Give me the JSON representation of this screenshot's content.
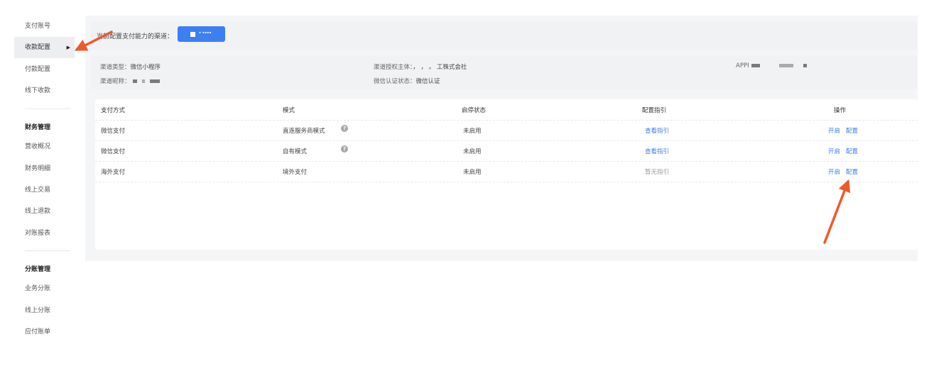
{
  "sidebar": {
    "items_top": [
      {
        "label": "支付账号"
      },
      {
        "label": "收款配置"
      },
      {
        "label": "付款配置"
      },
      {
        "label": "线下收款"
      }
    ],
    "group_finance": {
      "title": "财务管理",
      "items": [
        {
          "label": "营收概况"
        },
        {
          "label": "财务明细"
        },
        {
          "label": "线上交易"
        },
        {
          "label": "线上退款"
        },
        {
          "label": "对账报表"
        }
      ]
    },
    "group_split": {
      "title": "分账管理",
      "items": [
        {
          "label": "业务分账"
        },
        {
          "label": "线上分账"
        },
        {
          "label": "应付账单"
        }
      ]
    }
  },
  "channel_bar": {
    "label": "当前配置支付能力的渠道：",
    "chip_text": "▪ ▪▪▪▪"
  },
  "info": {
    "type_label": "渠道类型：",
    "type_value": "微信小程序",
    "subject_label": "渠道授权主体：",
    "subject_value": "，    ，  。  工株式会社",
    "appid_label": "APPI",
    "nickname_label": "渠道昵称：",
    "wechat_auth_label": "微信认证状态：",
    "wechat_auth_value": "微信认证"
  },
  "table": {
    "headers": {
      "method": "支付方式",
      "mode": "模式",
      "status": "启停状态",
      "guide": "配置指引",
      "ops": "操作"
    },
    "rows": [
      {
        "method": "微信支付",
        "mode": "直连服务商模式",
        "has_help": true,
        "status": "未启用",
        "guide": "查看指引",
        "guide_link": true,
        "op_enable": "开启",
        "op_config": "配置"
      },
      {
        "method": "微信支付",
        "mode": "自有模式",
        "has_help": true,
        "status": "未启用",
        "guide": "查看指引",
        "guide_link": true,
        "op_enable": "开启",
        "op_config": "配置"
      },
      {
        "method": "海外支付",
        "mode": "境外支付",
        "has_help": false,
        "status": "未启用",
        "guide": "暂无指引",
        "guide_link": false,
        "op_enable": "开启",
        "op_config": "配置"
      }
    ]
  },
  "colors": {
    "accent": "#3d7ff0",
    "link": "#3b7ee8",
    "annotation_arrow": "#ee5a2a"
  }
}
